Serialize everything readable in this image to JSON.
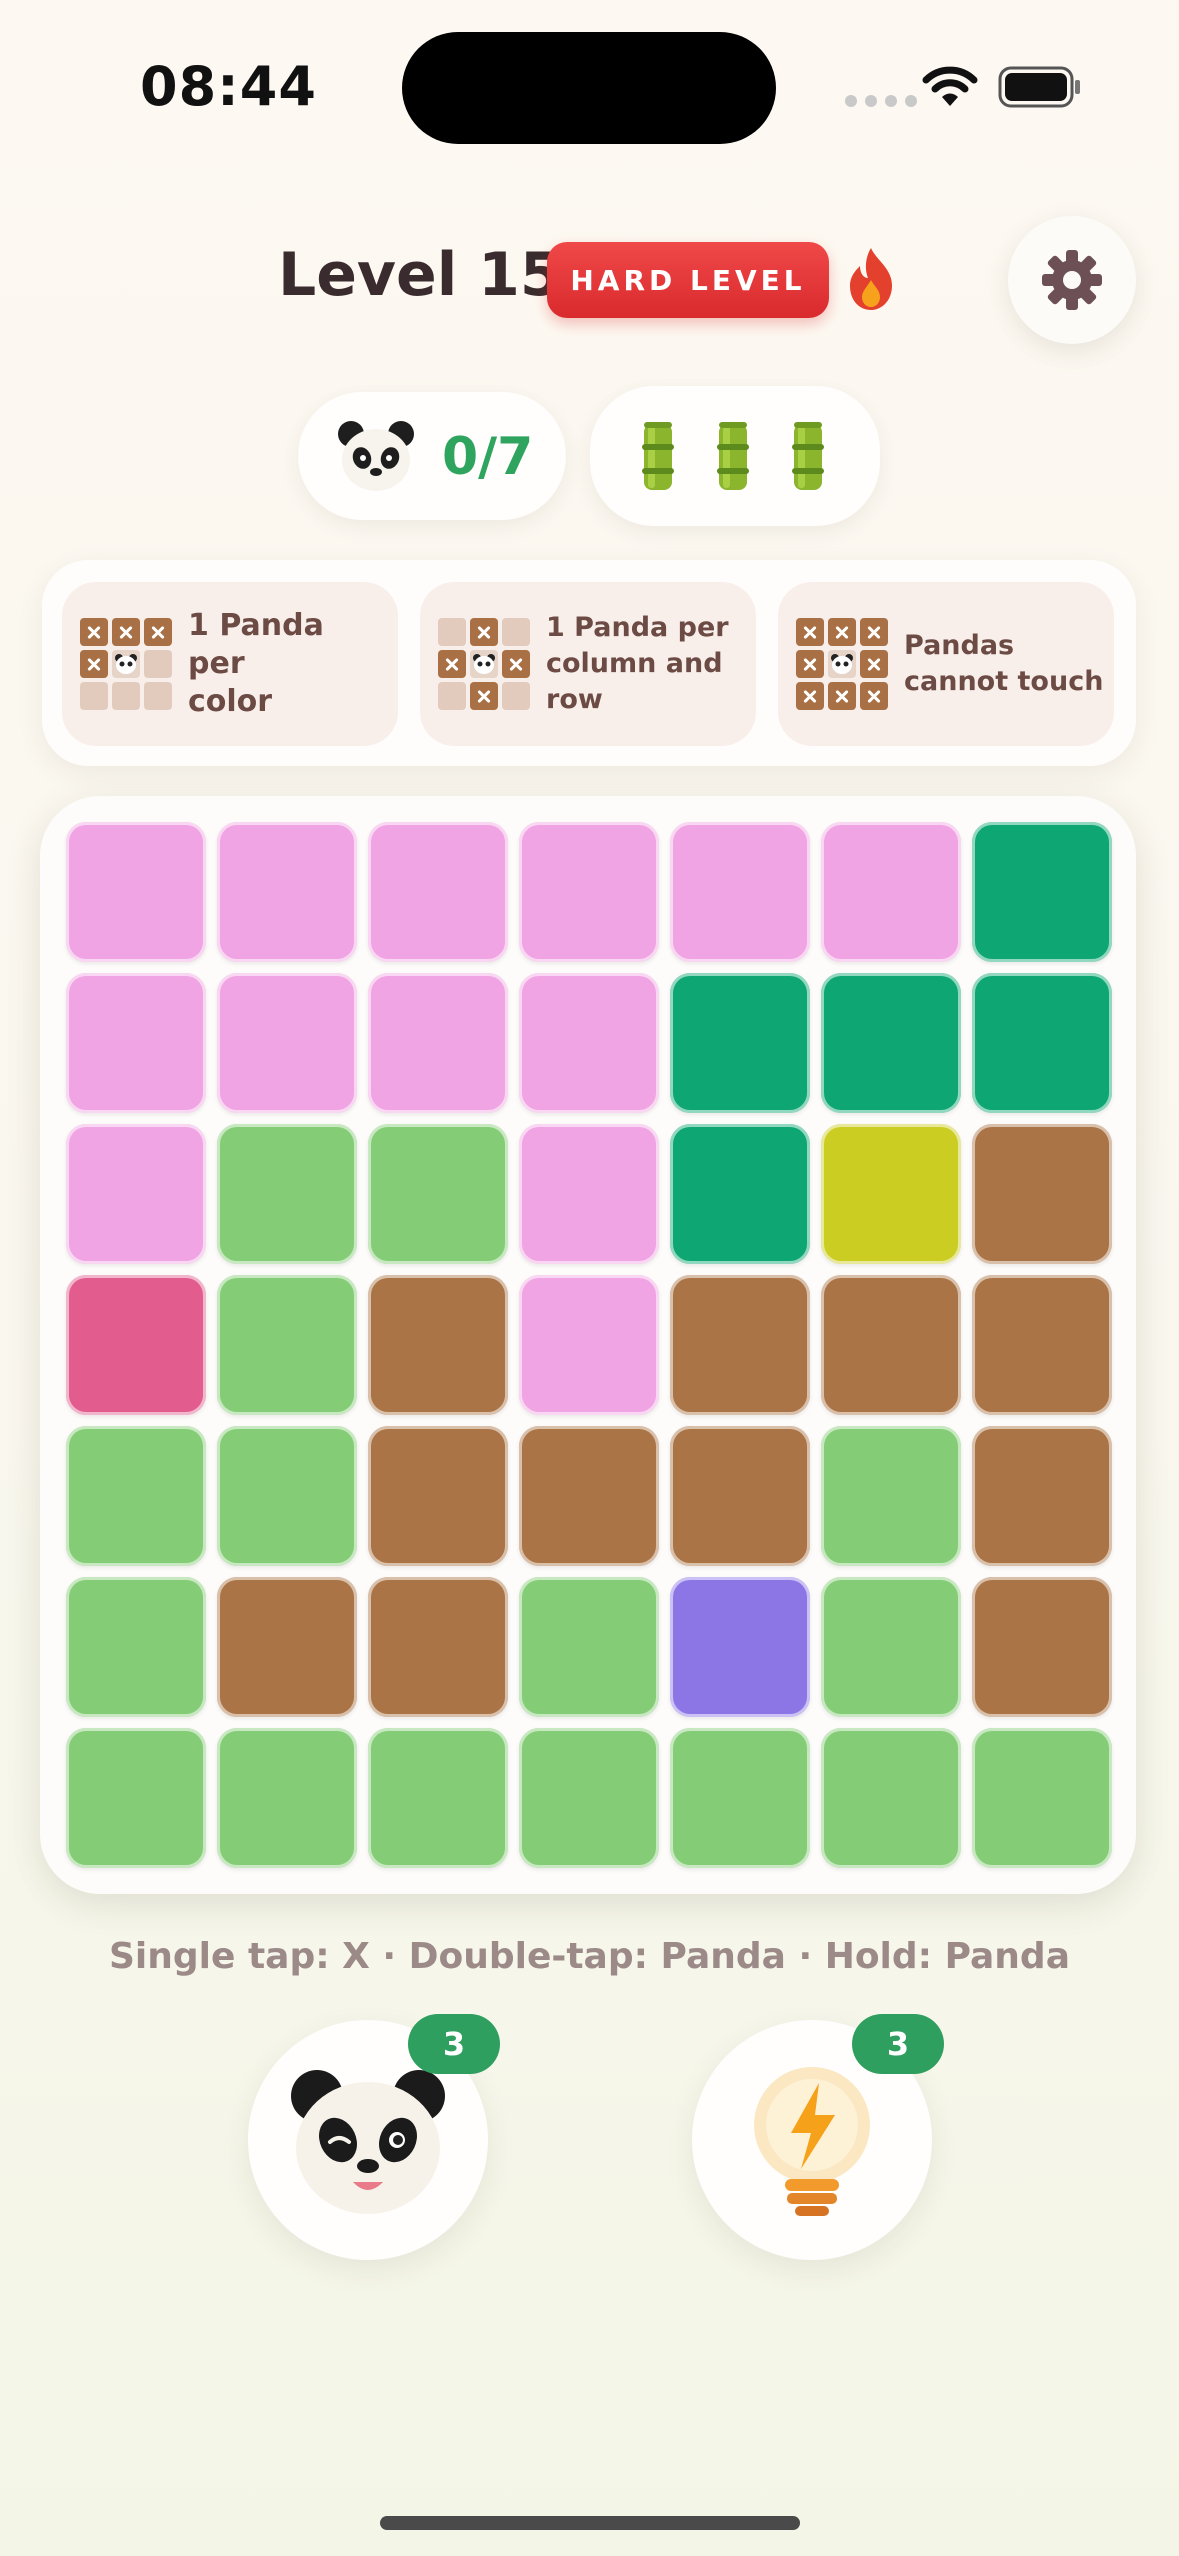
{
  "status_bar": {
    "time": "08:44"
  },
  "header": {
    "level_title": "Level 15",
    "difficulty_badge": "HARD LEVEL",
    "fire_icon": "fire-icon",
    "settings_icon": "gear-icon"
  },
  "progress": {
    "pandas_placed": "0/7",
    "panda_icon": "panda-face-icon",
    "bamboo_lives": 3,
    "bamboo_icon": "bamboo-icon"
  },
  "rules": [
    {
      "text": "1 Panda per color",
      "icon": "grid-x-panda-icon"
    },
    {
      "text": "1 Panda per column and row",
      "icon": "grid-cross-panda-icon"
    },
    {
      "text": "Pandas cannot touch",
      "icon": "grid-surround-panda-icon"
    }
  ],
  "palette": {
    "P": "#f1a4e3",
    "T": "#0ea672",
    "G": "#84cd76",
    "Y": "#cccd22",
    "B": "#ab7446",
    "M": "#e25d8e",
    "V": "#8c76e6"
  },
  "board": [
    [
      "P",
      "P",
      "P",
      "P",
      "P",
      "P",
      "T"
    ],
    [
      "P",
      "P",
      "P",
      "P",
      "T",
      "T",
      "T"
    ],
    [
      "P",
      "G",
      "G",
      "P",
      "T",
      "Y",
      "B"
    ],
    [
      "M",
      "G",
      "B",
      "P",
      "B",
      "B",
      "B"
    ],
    [
      "G",
      "G",
      "B",
      "B",
      "B",
      "G",
      "B"
    ],
    [
      "G",
      "B",
      "B",
      "G",
      "V",
      "G",
      "B"
    ],
    [
      "G",
      "G",
      "G",
      "G",
      "G",
      "G",
      "G"
    ]
  ],
  "instructions": "Single tap: X · Double-tap: Panda · Hold: Panda",
  "boosters": [
    {
      "name": "panda-hint",
      "icon": "winking-panda-icon",
      "count": "3"
    },
    {
      "name": "lightbulb-hint",
      "icon": "lightbulb-bolt-icon",
      "count": "3"
    }
  ]
}
